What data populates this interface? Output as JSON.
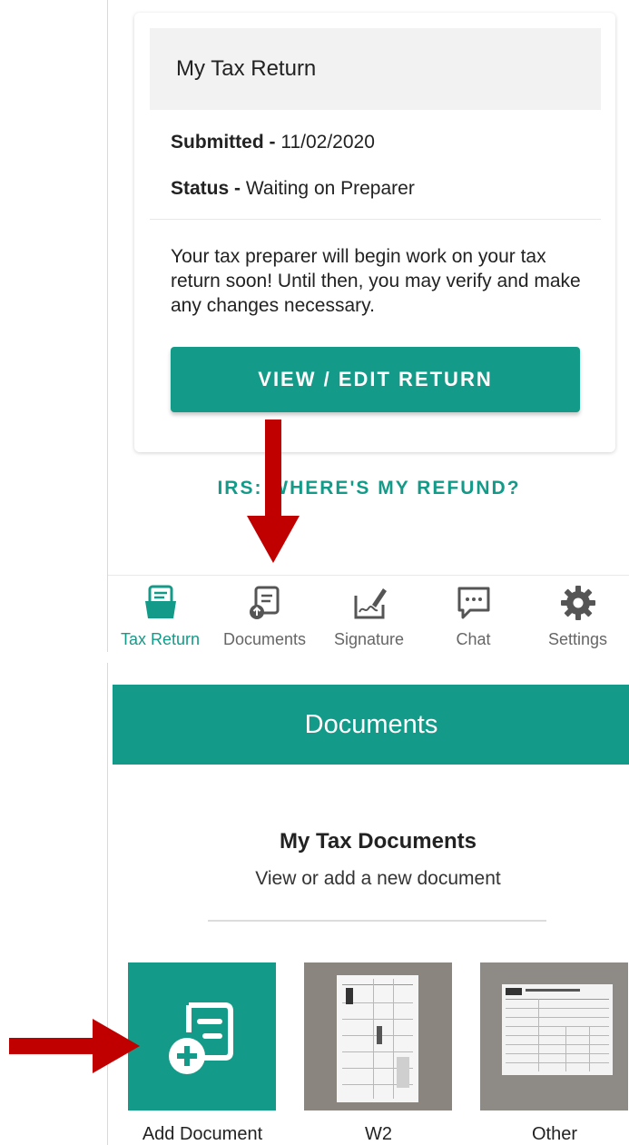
{
  "top": {
    "card": {
      "title": "My Tax Return",
      "submitted_label": "Submitted -",
      "submitted_value": "11/02/2020",
      "status_label": "Status -",
      "status_value": "Waiting on Preparer",
      "description": "Your tax preparer will begin work on your tax return soon! Until then, you may verify and make any changes necessary.",
      "edit_button": "VIEW / EDIT RETURN"
    },
    "refund_link": "IRS: WHERE'S MY REFUND?",
    "nav": {
      "items": [
        {
          "label": "Tax Return",
          "icon": "folder-icon",
          "active": true
        },
        {
          "label": "Documents",
          "icon": "documents-upload-icon",
          "active": false
        },
        {
          "label": "Signature",
          "icon": "signature-icon",
          "active": false
        },
        {
          "label": "Chat",
          "icon": "chat-icon",
          "active": false
        },
        {
          "label": "Settings",
          "icon": "gear-icon",
          "active": false
        }
      ]
    }
  },
  "bottom": {
    "app_bar_title": "Documents",
    "section_title": "My Tax Documents",
    "section_subtitle": "View or add a new document",
    "tiles": [
      {
        "label": "Add Document",
        "icon": "add-document-icon"
      },
      {
        "label": "W2",
        "icon": "w2-thumbnail"
      },
      {
        "label": "Other",
        "icon": "form-thumbnail"
      }
    ]
  },
  "colors": {
    "accent": "#149a88",
    "annotation_arrow": "#c00000",
    "nav_inactive": "#666666"
  }
}
